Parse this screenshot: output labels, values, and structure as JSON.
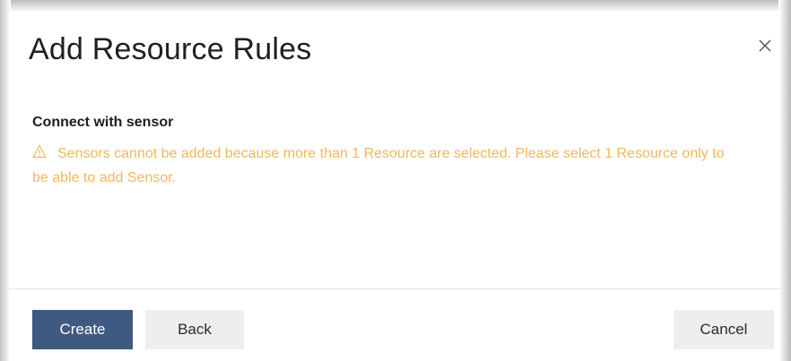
{
  "dialog": {
    "title": "Add Resource Rules",
    "close_icon": "close-icon"
  },
  "section": {
    "label": "Connect with sensor",
    "warning_icon": "warning-triangle-icon",
    "warning_text": "Sensors cannot be added because more than 1 Resource are selected. Please select 1 Resource only to be able to add Sensor."
  },
  "footer": {
    "create_label": "Create",
    "back_label": "Back",
    "cancel_label": "Cancel"
  },
  "colors": {
    "primary_button": "#3f5a80",
    "secondary_button": "#eeeeee",
    "warning_text": "#f3b75b",
    "title_text": "#1f1f1f"
  }
}
